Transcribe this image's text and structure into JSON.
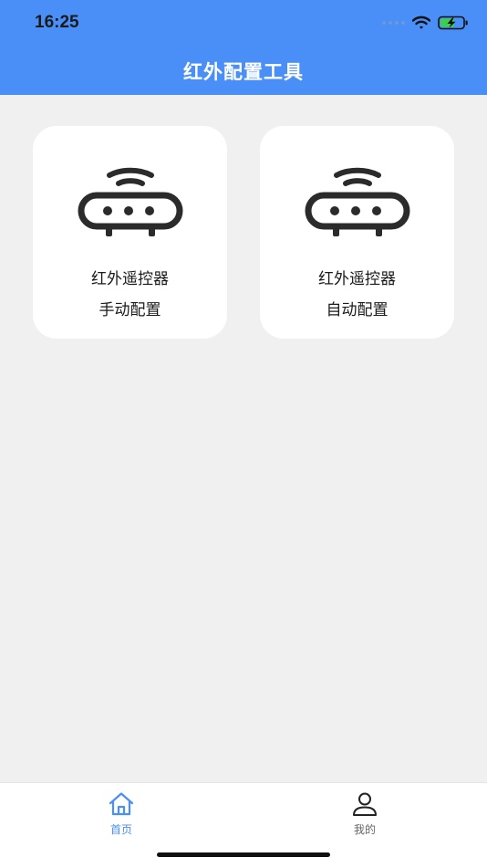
{
  "status_bar": {
    "time": "16:25"
  },
  "header": {
    "title": "红外配置工具",
    "background_color": "#4a8ff7"
  },
  "cards": [
    {
      "icon": "router-icon",
      "line1": "红外遥控器",
      "line2": "手动配置"
    },
    {
      "icon": "router-icon",
      "line1": "红外遥控器",
      "line2": "自动配置"
    }
  ],
  "tabbar": {
    "tabs": [
      {
        "label": "首页",
        "icon": "home-icon",
        "active": true,
        "color": "#4a8ff7"
      },
      {
        "label": "我的",
        "icon": "user-icon",
        "active": false,
        "color": "#666666"
      }
    ]
  }
}
